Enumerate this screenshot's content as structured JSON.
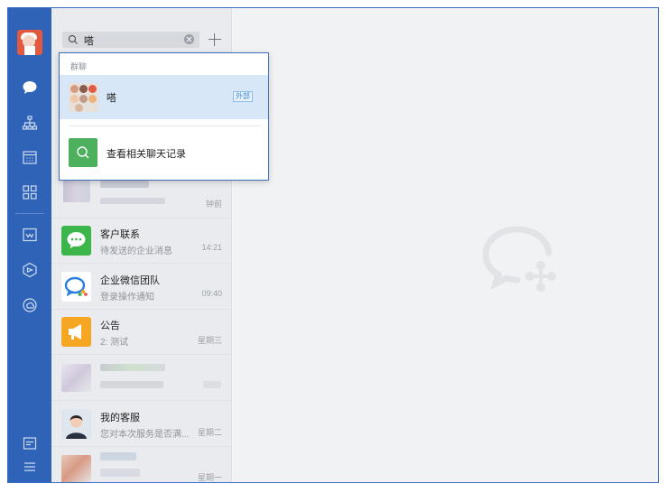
{
  "search": {
    "query": "嗒"
  },
  "dropdown": {
    "section_label": "群聊",
    "result": {
      "name": "嗒",
      "tag": "外部"
    },
    "more_label": "查看相关聊天记录"
  },
  "conversations": [
    {
      "name": "",
      "preview": "",
      "time": "钟前"
    },
    {
      "name": "客户联系",
      "preview": "待发送的企业消息",
      "time": "14:21"
    },
    {
      "name": "企业微信团队",
      "preview": "登录操作通知",
      "time": "09:40"
    },
    {
      "name": "公告",
      "preview": "2: 测试",
      "time": "星期三"
    },
    {
      "name": "",
      "preview": "",
      "time": ""
    },
    {
      "name": "我的客服",
      "preview": "您对本次服务是否满...",
      "time": "星期二"
    },
    {
      "name": "",
      "preview": "",
      "time": "星期一"
    }
  ],
  "colors": {
    "rail": "#2e63b8",
    "accent": "#3f6fba",
    "green": "#4db05c",
    "orange": "#f5a623"
  }
}
